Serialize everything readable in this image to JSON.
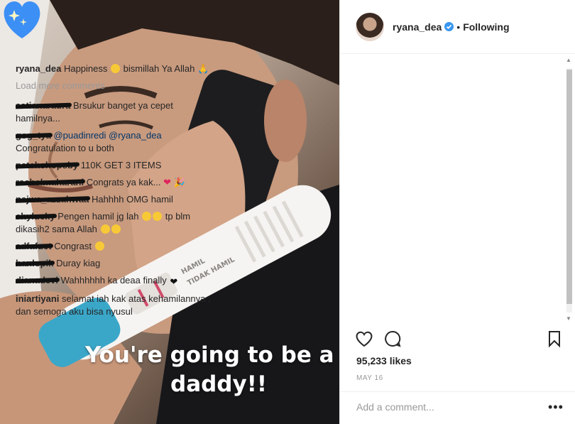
{
  "post": {
    "caption_line1": "You're going to be a",
    "caption_line2": "daddy!!",
    "test_label1": "HAMIL",
    "test_label2": "TIDAK HAMIL"
  },
  "header": {
    "username": "ryana_dea",
    "separator": "•",
    "follow_status": "Following"
  },
  "caption_comment": {
    "username": "ryana_dea",
    "text": "Happiness",
    "text2": "bismillah Ya Allah"
  },
  "load_more": "Load more comments",
  "comments": [
    {
      "username": "astianaraura",
      "text": "Brsukur banget ya cepet hamilnya..."
    },
    {
      "username": "gog_tya",
      "mention1": "@puadinredi",
      "mention2": "@ryana_dea",
      "text": "Congratulation to u both"
    },
    {
      "username": "patchshopsby",
      "text": "110K GET 3 ITEMS"
    },
    {
      "username": "rachelmaharani",
      "text": "Congrats ya kak..."
    },
    {
      "username": "najwa_azzahwaa",
      "text": "Hahhhh OMG hamil"
    },
    {
      "username": "chylucky",
      "text": "Pengen hamil jg lah",
      "text2": "tp blm dikasih2 sama Allah"
    },
    {
      "username": "adfafuct",
      "text": "Congrast"
    },
    {
      "username": "hanlopik",
      "text": "Duray kiag"
    },
    {
      "username": "dianadevi",
      "text": "Wahhhhhh ka deaa finally"
    },
    {
      "username": "iniartiyani",
      "text": "selamat iah kak atas kehamilannya , dan semoga aku bisa nyusul"
    }
  ],
  "likes": "95,233 likes",
  "date": "MAY 16",
  "add_comment_placeholder": "Add a comment...",
  "more_label": "•••",
  "colors": {
    "heart_blue": "#3c8ff5",
    "test_teal": "#3aa7c9",
    "mention": "#003569"
  }
}
